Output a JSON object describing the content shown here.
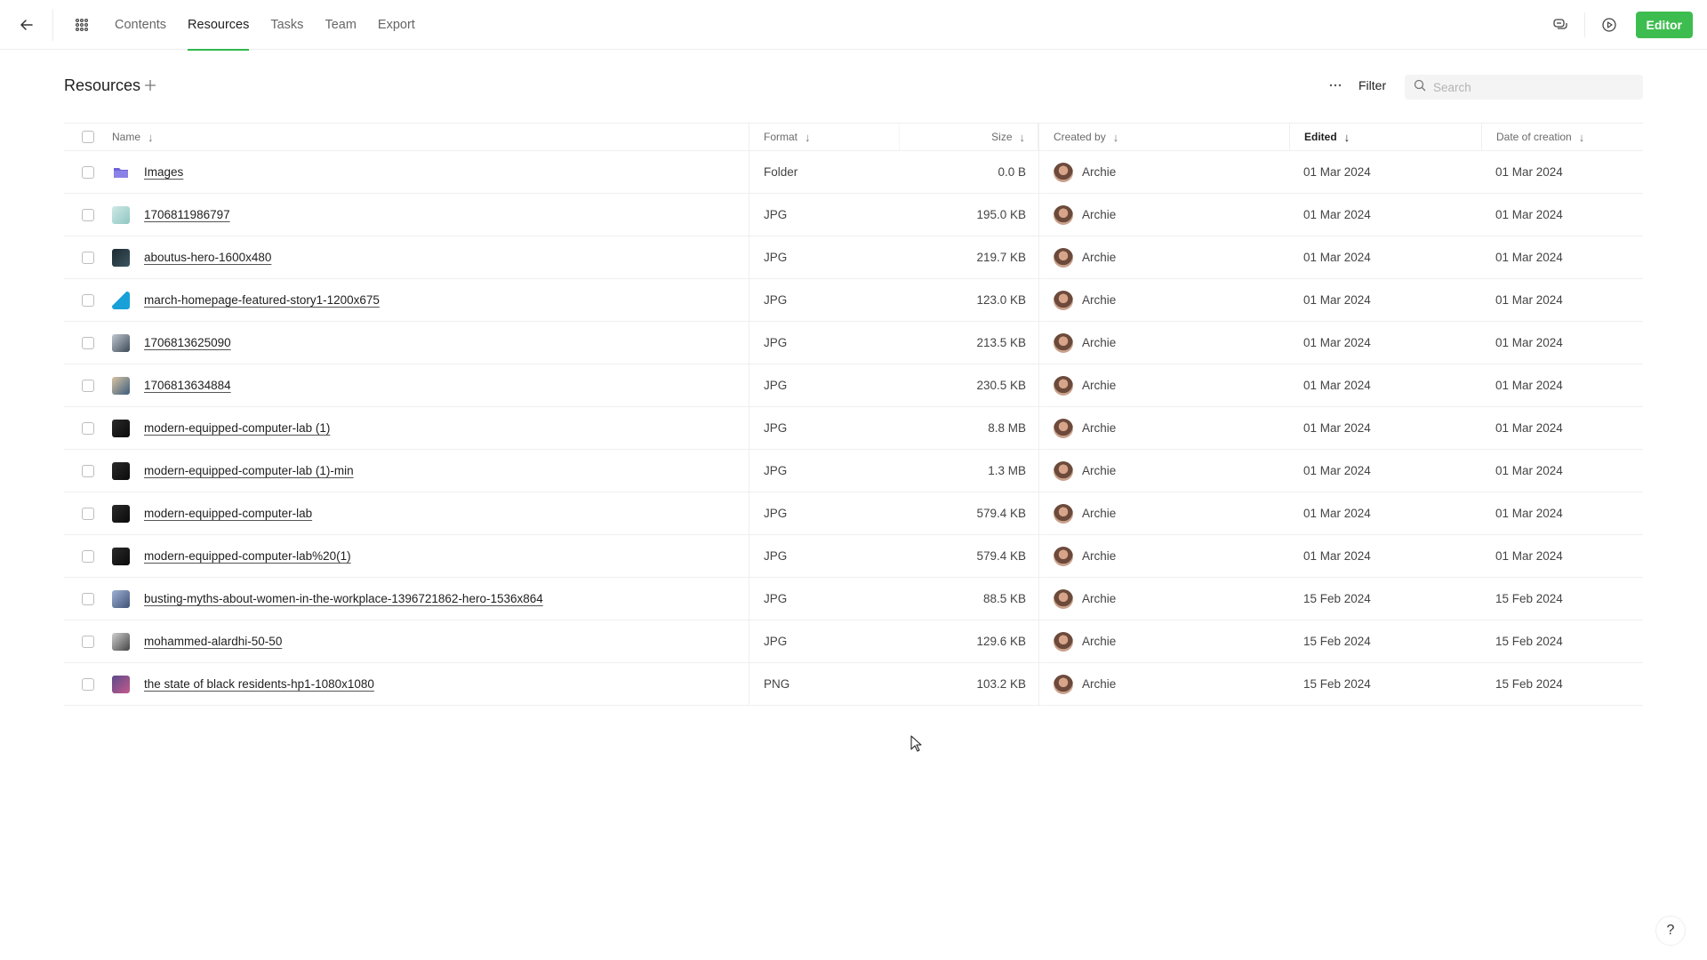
{
  "nav": {
    "tabs": [
      {
        "label": "Contents",
        "active": false
      },
      {
        "label": "Resources",
        "active": true
      },
      {
        "label": "Tasks",
        "active": false
      },
      {
        "label": "Team",
        "active": false
      },
      {
        "label": "Export",
        "active": false
      }
    ],
    "editor_label": "Editor"
  },
  "header": {
    "title": "Resources",
    "filter_label": "Filter",
    "search_placeholder": "Search"
  },
  "table": {
    "columns": {
      "name": "Name",
      "format": "Format",
      "size": "Size",
      "created_by": "Created by",
      "edited": "Edited",
      "date_of_creation": "Date of creation"
    },
    "rows": [
      {
        "name": "Images",
        "format": "Folder",
        "size": "0.0 B",
        "created_by": "Archie",
        "edited": "01 Mar 2024",
        "created": "01 Mar 2024",
        "thumb": "folder-icon"
      },
      {
        "name": "1706811986797",
        "format": "JPG",
        "size": "195.0 KB",
        "created_by": "Archie",
        "edited": "01 Mar 2024",
        "created": "01 Mar 2024",
        "thumb": "image-thumbnail"
      },
      {
        "name": "aboutus-hero-1600x480",
        "format": "JPG",
        "size": "219.7 KB",
        "created_by": "Archie",
        "edited": "01 Mar 2024",
        "created": "01 Mar 2024",
        "thumb": "image-thumbnail"
      },
      {
        "name": "march-homepage-featured-story1-1200x675",
        "format": "JPG",
        "size": "123.0 KB",
        "created_by": "Archie",
        "edited": "01 Mar 2024",
        "created": "01 Mar 2024",
        "thumb": "image-thumbnail"
      },
      {
        "name": "1706813625090",
        "format": "JPG",
        "size": "213.5 KB",
        "created_by": "Archie",
        "edited": "01 Mar 2024",
        "created": "01 Mar 2024",
        "thumb": "image-thumbnail"
      },
      {
        "name": "1706813634884",
        "format": "JPG",
        "size": "230.5 KB",
        "created_by": "Archie",
        "edited": "01 Mar 2024",
        "created": "01 Mar 2024",
        "thumb": "image-thumbnail"
      },
      {
        "name": "modern-equipped-computer-lab (1)",
        "format": "JPG",
        "size": "8.8 MB",
        "created_by": "Archie",
        "edited": "01 Mar 2024",
        "created": "01 Mar 2024",
        "thumb": "image-thumbnail"
      },
      {
        "name": "modern-equipped-computer-lab (1)-min",
        "format": "JPG",
        "size": "1.3 MB",
        "created_by": "Archie",
        "edited": "01 Mar 2024",
        "created": "01 Mar 2024",
        "thumb": "image-thumbnail"
      },
      {
        "name": "modern-equipped-computer-lab",
        "format": "JPG",
        "size": "579.4 KB",
        "created_by": "Archie",
        "edited": "01 Mar 2024",
        "created": "01 Mar 2024",
        "thumb": "image-thumbnail"
      },
      {
        "name": "modern-equipped-computer-lab%20(1)",
        "format": "JPG",
        "size": "579.4 KB",
        "created_by": "Archie",
        "edited": "01 Mar 2024",
        "created": "01 Mar 2024",
        "thumb": "image-thumbnail"
      },
      {
        "name": "busting-myths-about-women-in-the-workplace-1396721862-hero-1536x864",
        "format": "JPG",
        "size": "88.5 KB",
        "created_by": "Archie",
        "edited": "15 Feb 2024",
        "created": "15 Feb 2024",
        "thumb": "image-thumbnail"
      },
      {
        "name": "mohammed-alardhi-50-50",
        "format": "JPG",
        "size": "129.6 KB",
        "created_by": "Archie",
        "edited": "15 Feb 2024",
        "created": "15 Feb 2024",
        "thumb": "image-thumbnail"
      },
      {
        "name": "the state of black residents-hp1-1080x1080",
        "format": "PNG",
        "size": "103.2 KB",
        "created_by": "Archie",
        "edited": "15 Feb 2024",
        "created": "15 Feb 2024",
        "thumb": "image-thumbnail"
      }
    ]
  },
  "colors": {
    "accent": "#3dbd4f",
    "folder": "#6d63d8"
  }
}
